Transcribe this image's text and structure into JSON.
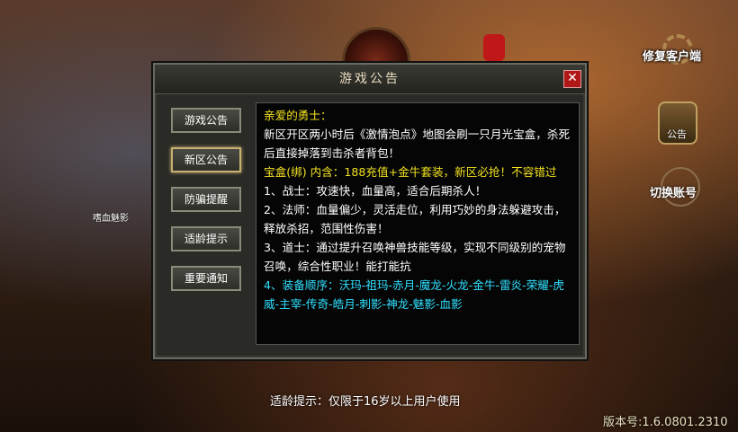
{
  "dialog": {
    "title": "游戏公告",
    "close_label": "✕",
    "tabs": [
      {
        "label": "游戏公告"
      },
      {
        "label": "新区公告",
        "active": true
      },
      {
        "label": "防骗提醒"
      },
      {
        "label": "适龄提示"
      },
      {
        "label": "重要通知"
      }
    ],
    "content": {
      "greeting": "亲爱的勇士：",
      "para1": "新区开区两小时后《激情泡点》地图会刷一只月光宝盒，杀死后直接掉落到击杀者背包！",
      "para2": "宝盒(绑) 内含：188充值+金牛套装，新区必抢！不容错过",
      "para3": "1、战士：攻速快，血量高，适合后期杀人！",
      "para4": "2、法师：血量偏少，灵活走位，利用巧妙的身法躲避攻击，释放杀招，范围性伤害！",
      "para5": "3、道士：通过提升召唤神兽技能等级，实现不同级别的宠物召唤，综合性职业！能打能抗",
      "para6": "4、装备顺序：沃玛-祖玛-赤月-魔龙-火龙-金牛-雷炎-荣耀-虎威-主宰-传奇-皓月-刺影-神龙-魅影-血影"
    }
  },
  "side": {
    "repair_client": "修复客户端",
    "notice": "公告",
    "switch_account": "切换账号"
  },
  "character_label": "嗜血魅影",
  "age_notice": "适龄提示：仅限于16岁以上用户使用",
  "version": "版本号:1.6.0801.2310",
  "colors": {
    "highlight_yellow": "#f0e020",
    "highlight_cyan": "#30e0ff",
    "close_red": "#b01818"
  }
}
